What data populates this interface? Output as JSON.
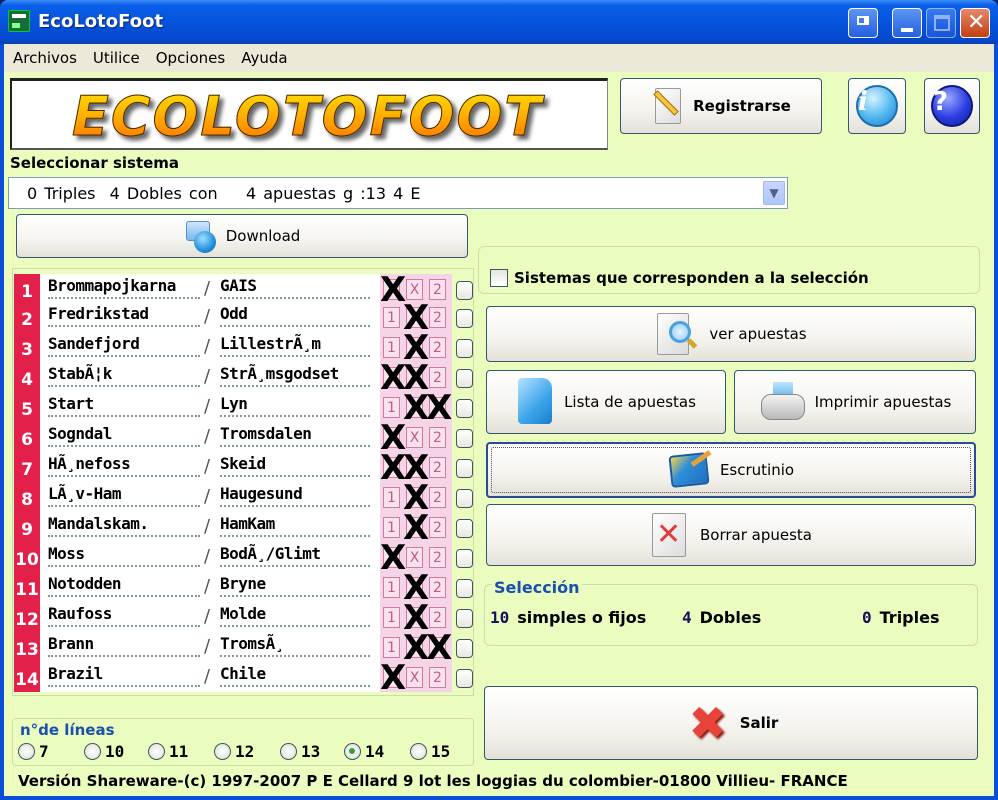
{
  "window": {
    "title": "EcoLotoFoot",
    "controls": [
      "extra",
      "minimize",
      "maximize",
      "close"
    ]
  },
  "menu": [
    "Archivos",
    "Utilice",
    "Opciones",
    "Ayuda"
  ],
  "header": {
    "logo_text": "ECOLOTOFOOT",
    "register_label": "Registrarse",
    "info_icon": "i",
    "help_icon": "?"
  },
  "system": {
    "label": "Seleccionar sistema",
    "selected": "0 Triples  4 Dobles con    4 apuestas g :13 4 E",
    "download_label": "Download"
  },
  "matches": [
    {
      "num": "1",
      "home": "Brommapojkarna",
      "away": "GAIS",
      "picks": [
        "1"
      ],
      "checked": false
    },
    {
      "num": "2",
      "home": "Fredrikstad",
      "away": "Odd",
      "picks": [
        "X"
      ],
      "checked": false
    },
    {
      "num": "3",
      "home": "Sandefjord",
      "away": "LillestrÃ¸m",
      "picks": [
        "X"
      ],
      "checked": false
    },
    {
      "num": "4",
      "home": "StabÃ¦k",
      "away": "StrÃ¸msgodset",
      "picks": [
        "1",
        "X"
      ],
      "checked": false
    },
    {
      "num": "5",
      "home": "Start",
      "away": "Lyn",
      "picks": [
        "X",
        "2"
      ],
      "checked": false
    },
    {
      "num": "6",
      "home": "Sogndal",
      "away": "Tromsdalen",
      "picks": [
        "1"
      ],
      "checked": false
    },
    {
      "num": "7",
      "home": "HÃ¸nefoss",
      "away": "Skeid",
      "picks": [
        "1",
        "X"
      ],
      "checked": false
    },
    {
      "num": "8",
      "home": "LÃ¸v-Ham",
      "away": "Haugesund",
      "picks": [
        "X"
      ],
      "checked": false
    },
    {
      "num": "9",
      "home": "Mandalskam.",
      "away": "HamKam",
      "picks": [
        "X"
      ],
      "checked": false
    },
    {
      "num": "10",
      "home": "Moss",
      "away": "BodÃ¸/Glimt",
      "picks": [
        "1"
      ],
      "checked": false
    },
    {
      "num": "11",
      "home": "Notodden",
      "away": "Bryne",
      "picks": [
        "X"
      ],
      "checked": false
    },
    {
      "num": "12",
      "home": "Raufoss",
      "away": "Molde",
      "picks": [
        "X"
      ],
      "checked": false
    },
    {
      "num": "13",
      "home": "Brann",
      "away": "TromsÃ¸",
      "picks": [
        "X",
        "2"
      ],
      "checked": false
    },
    {
      "num": "14",
      "home": "Brazil",
      "away": "Chile",
      "picks": [
        "1"
      ],
      "checked": false
    }
  ],
  "pick_labels": [
    "1",
    "X",
    "2"
  ],
  "lines": {
    "title": "n°de líneas",
    "options": [
      "7",
      "10",
      "11",
      "12",
      "13",
      "14",
      "15"
    ],
    "selected": "14"
  },
  "right": {
    "systems_checkbox_label": "Sistemas que corresponden a la selección",
    "systems_checkbox_checked": false,
    "ver_label": "ver apuestas",
    "lista_label": "Lista de apuestas",
    "imprimir_label": "Imprimir apuestas",
    "escrutinio_label": "Escrutinio",
    "borrar_label": "Borrar apuesta",
    "salir_label": "Salir"
  },
  "selection": {
    "title": "Selección",
    "simples_count": "10",
    "simples_label": "simples o fijos",
    "dobles_count": "4",
    "dobles_label": "Dobles",
    "triples_count": "0",
    "triples_label": "Triples"
  },
  "status_text": "Versión Shareware-(c) 1997-2007 P E Cellard 9 lot les loggias du colombier-01800 Villieu- FRANCE"
}
